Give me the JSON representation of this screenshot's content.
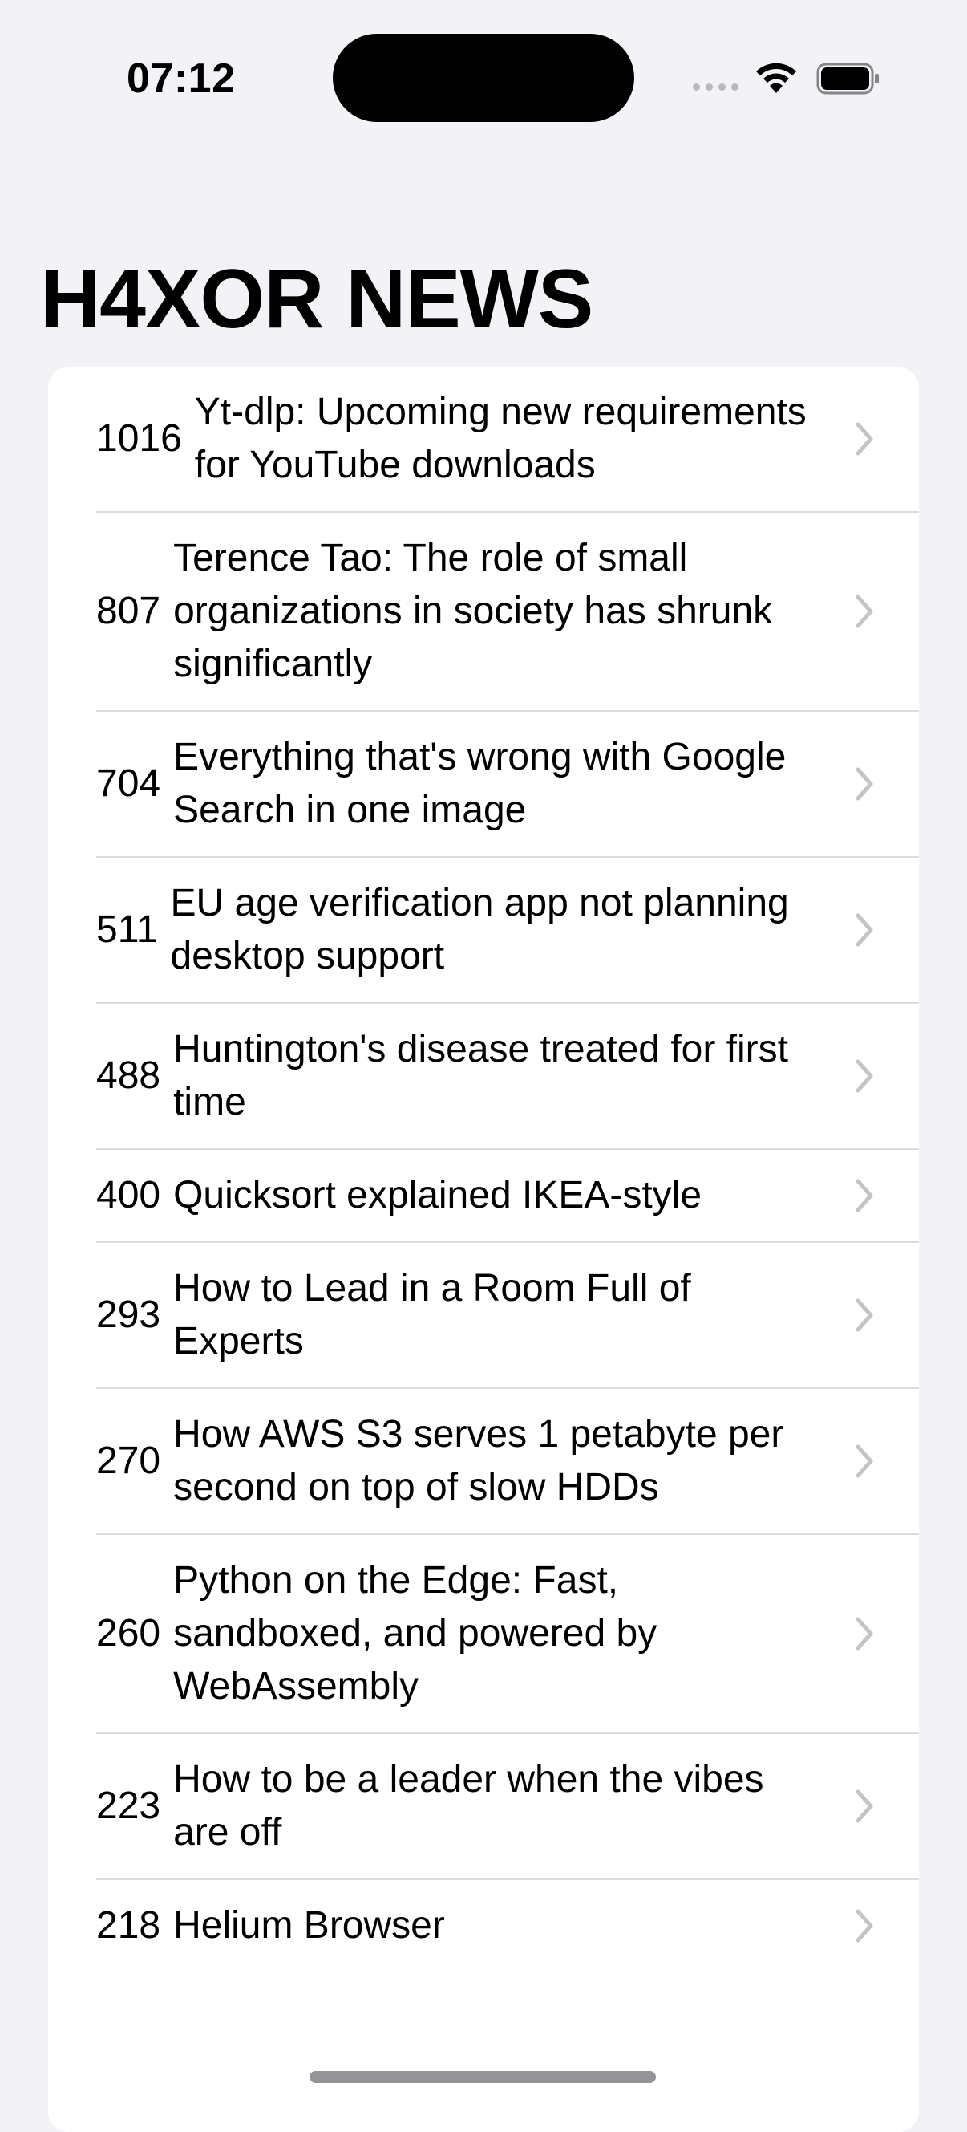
{
  "status_bar": {
    "time": "07:12"
  },
  "header": {
    "title": "H4XOR NEWS"
  },
  "stories": [
    {
      "points": "1016",
      "title": "Yt-dlp: Upcoming new requirements for YouTube downloads"
    },
    {
      "points": "807",
      "title": "Terence Tao: The role of small organizations in society has shrunk significantly"
    },
    {
      "points": "704",
      "title": "Everything that's wrong with Google Search in one image"
    },
    {
      "points": "511",
      "title": "EU age verification app not planning desktop support"
    },
    {
      "points": "488",
      "title": "Huntington's disease treated for first time"
    },
    {
      "points": "400",
      "title": "Quicksort explained IKEA-style"
    },
    {
      "points": "293",
      "title": "How to Lead in a Room Full of Experts"
    },
    {
      "points": "270",
      "title": "How AWS S3 serves 1 petabyte per second on top of slow HDDs"
    },
    {
      "points": "260",
      "title": "Python on the Edge: Fast, sandboxed, and powered by WebAssembly"
    },
    {
      "points": "223",
      "title": "How to be a leader when the vibes are off"
    },
    {
      "points": "218",
      "title": "Helium Browser"
    }
  ],
  "icons": {
    "row_chevron": "chevron-right-icon",
    "wifi": "wifi-icon",
    "battery": "battery-icon"
  },
  "colors": {
    "background": "#f2f2f7",
    "card": "#ffffff",
    "separator": "#dcdce0",
    "chevron": "#c4c4c7"
  }
}
